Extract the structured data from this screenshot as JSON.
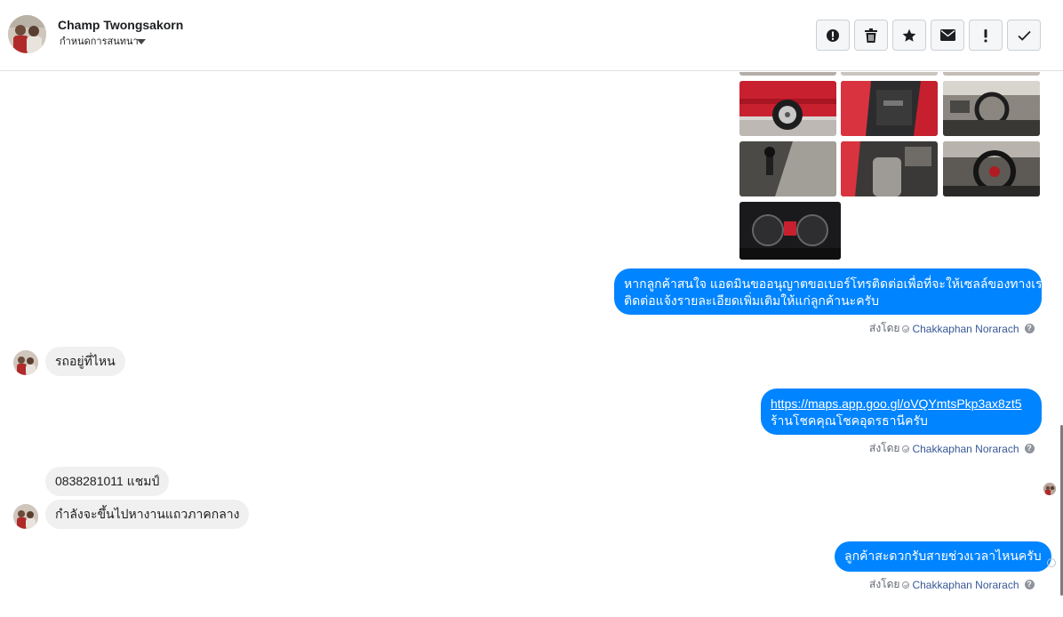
{
  "header": {
    "contact_name": "Champ Twongsakorn",
    "assign_label": "กำหนดการสนทนา",
    "toolbar": [
      {
        "icon": "alert-circle-icon",
        "name": "mark-spam-button"
      },
      {
        "icon": "trash-icon",
        "name": "delete-button"
      },
      {
        "icon": "star-icon",
        "name": "star-button"
      },
      {
        "icon": "envelope-icon",
        "name": "mark-unread-button"
      },
      {
        "icon": "exclamation-icon",
        "name": "follow-up-button"
      },
      {
        "icon": "checkmark-icon",
        "name": "mark-done-button"
      }
    ]
  },
  "messages": {
    "out_1": {
      "line1": "หากลูกค้าสนใจ แอดมินขออนุญาตขอเบอร์โทรติดต่อเพื่อที่จะให้เซลล์ของทางเรา",
      "line2": "ติดต่อแจ้งรายละเอียดเพิ่มเติมให้แก่ลูกค้านะครับ"
    },
    "in_1": "รถอยู่ที่ไหน",
    "out_2": {
      "link": "https://maps.app.goo.gl/oVQYmtsPkp3ax8zt5",
      "line2": "ร้านโชคคุณโชคอุดรธานีครับ"
    },
    "in_2": "0838281011 แชมป์",
    "in_3": "กำลังจะขึ้นไปหางานแถวภาคกลาง",
    "out_3": "ลูกค้าสะดวกรับสายช่วงเวลาไหนครับ"
  },
  "sent_by": {
    "prefix": "ส่งโดย",
    "agent": "Chakkaphan Norarach",
    "help": "?"
  },
  "colors": {
    "outgoing_bubble": "#0084ff",
    "incoming_bubble": "#f1f0f0",
    "agent_link": "#385898"
  }
}
